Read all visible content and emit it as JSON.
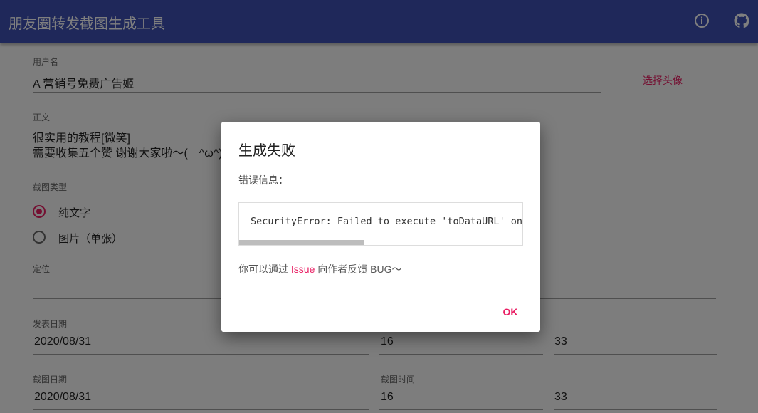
{
  "app": {
    "title": "朋友圈转发截图生成工具"
  },
  "header": {
    "info_icon": "info-icon",
    "github_icon": "github-icon"
  },
  "form": {
    "username": {
      "label": "用户名",
      "value": "A 营销号免费广告姬",
      "avatar_button": "选择头像"
    },
    "body": {
      "label": "正文",
      "line1": "很实用的教程[微笑]",
      "line2": "需要收集五个赞 谢谢大家啦～(　^ω^)"
    },
    "screenshot_type": {
      "label": "截图类型",
      "options": [
        "纯文字",
        "图片（单张）"
      ],
      "selected": "纯文字"
    },
    "location": {
      "label": "定位",
      "value": ""
    },
    "publish": {
      "label": "发表日期",
      "date": "2020/08/31",
      "hour": "16",
      "minute": "33"
    },
    "capture": {
      "date_label": "截图日期",
      "date": "2020/08/31",
      "time_label": "截图时间",
      "hour": "16",
      "minute": "33"
    }
  },
  "dialog": {
    "title": "生成失败",
    "error_label": "错误信息：",
    "error_text": "SecurityError: Failed to execute 'toDataURL' on 'HTMLCanvasElement': Tainted canvases may not be exported.",
    "tip_prefix": "你可以通过",
    "tip_link": "Issue",
    "tip_suffix": "向作者反馈 BUG～",
    "ok_label": "OK"
  },
  "colors": {
    "primary": "#3f51b5",
    "accent": "#e91e63",
    "overlay": "rgba(0,0,0,0.5)"
  }
}
